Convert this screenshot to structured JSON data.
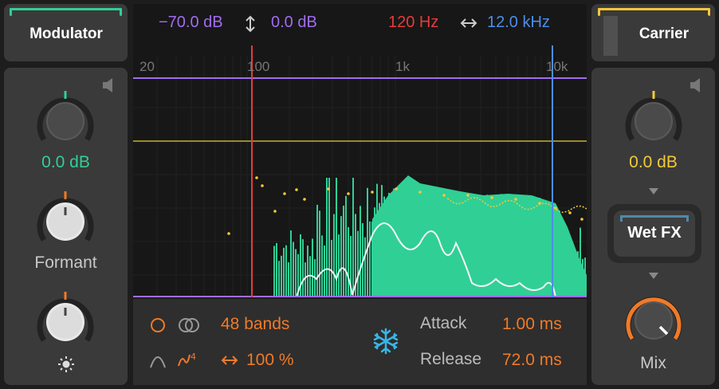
{
  "colors": {
    "accent_green": "#2fcf95",
    "accent_yellow": "#f3c93a",
    "orange": "#f07a28",
    "purple": "#a06cf0",
    "red": "#e53b3b",
    "blue": "#4c8ee8",
    "olive": "#9c8a2a"
  },
  "modulator": {
    "title": "Modulator",
    "gain_value": "0.0 dB",
    "formant_label": "Formant",
    "brightness_icon": "sun-icon"
  },
  "carrier": {
    "title": "Carrier",
    "gain_value": "0.0 dB",
    "wet_fx_label": "Wet FX",
    "mix_label": "Mix"
  },
  "display": {
    "min_db": "−70.0 dB",
    "db_icon": "updown-arrow-icon",
    "max_db": "0.0 dB",
    "low_freq": "120 Hz",
    "freq_icon": "leftright-arrow-icon",
    "high_freq": "12.0 kHz",
    "freq_axis": [
      "20",
      "100",
      "1k",
      "10k"
    ]
  },
  "bottom": {
    "bands": "48 bands",
    "spread_icon": "leftright-arrow-icon",
    "spread": "100 %",
    "freeze_icon": "snowflake-icon",
    "attack_label": "Attack",
    "attack_value": "1.00 ms",
    "release_label": "Release",
    "release_value": "72.0 ms"
  }
}
